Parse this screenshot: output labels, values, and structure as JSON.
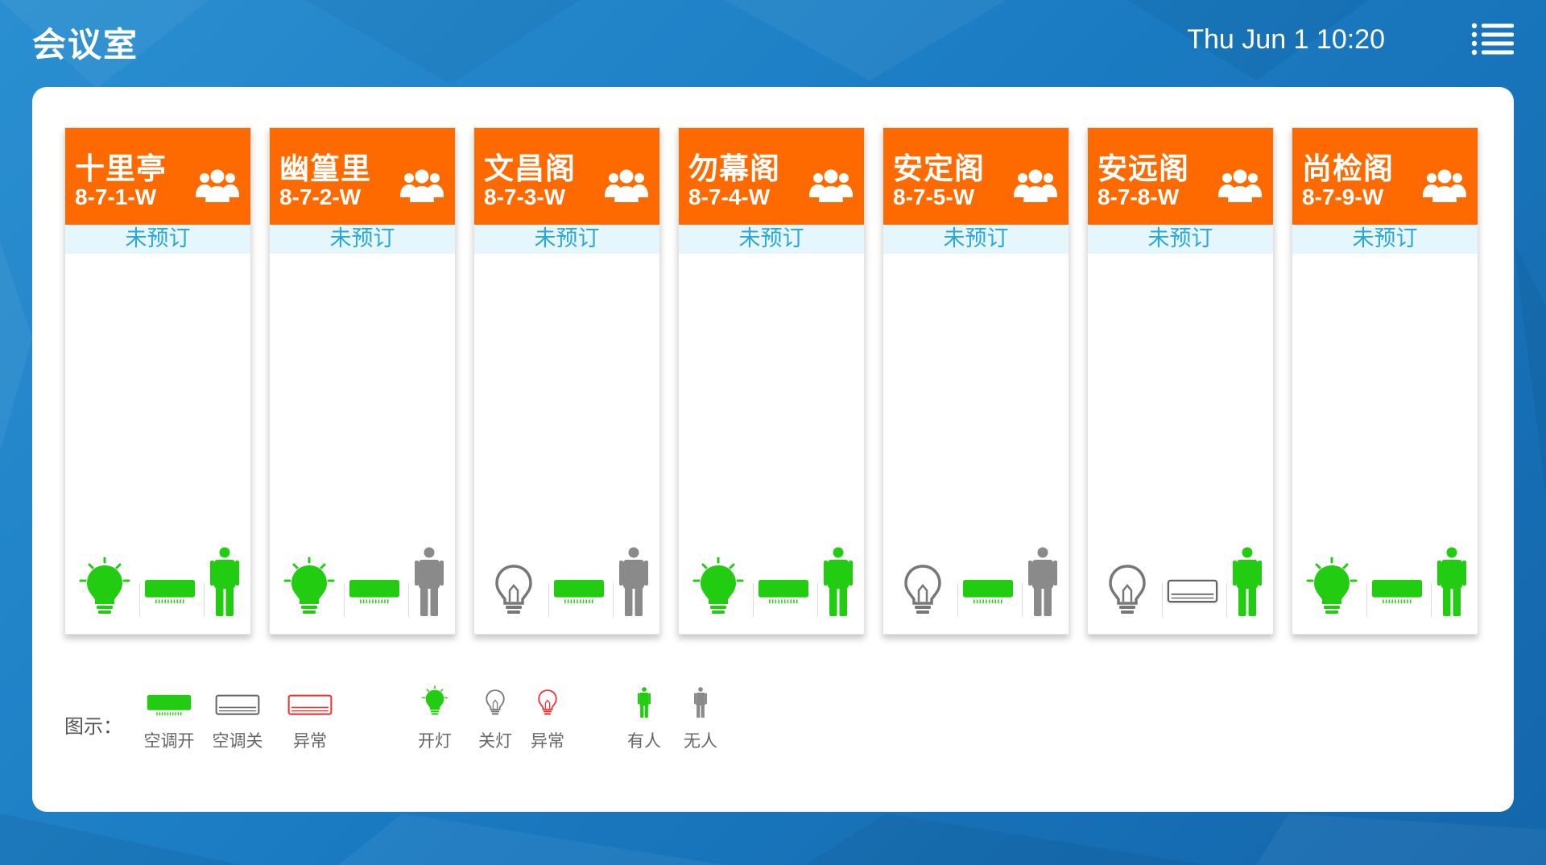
{
  "header": {
    "title": "会议室",
    "datetime": "Thu Jun 1 10:20",
    "menu_icon": "list-menu-icon"
  },
  "rooms": [
    {
      "name": "十里亭",
      "code": "8-7-1-W",
      "status": "未预订",
      "light": "on",
      "ac": "on",
      "occupancy": "occupied"
    },
    {
      "name": "幽篁里",
      "code": "8-7-2-W",
      "status": "未预订",
      "light": "on",
      "ac": "on",
      "occupancy": "vacant"
    },
    {
      "name": "文昌阁",
      "code": "8-7-3-W",
      "status": "未预订",
      "light": "off",
      "ac": "on",
      "occupancy": "vacant"
    },
    {
      "name": "勿幕阁",
      "code": "8-7-4-W",
      "status": "未预订",
      "light": "on",
      "ac": "on",
      "occupancy": "occupied"
    },
    {
      "name": "安定阁",
      "code": "8-7-5-W",
      "status": "未预订",
      "light": "off",
      "ac": "on",
      "occupancy": "vacant"
    },
    {
      "name": "安远阁",
      "code": "8-7-8-W",
      "status": "未预订",
      "light": "off",
      "ac": "off",
      "occupancy": "occupied"
    },
    {
      "name": "尚检阁",
      "code": "8-7-9-W",
      "status": "未预订",
      "light": "on",
      "ac": "on",
      "occupancy": "occupied"
    }
  ],
  "legend": {
    "title": "图示：",
    "items": [
      {
        "icon": "ac-on",
        "label": "空调开"
      },
      {
        "icon": "ac-off",
        "label": "空调关"
      },
      {
        "icon": "ac-error",
        "label": "异常"
      },
      {
        "icon": "light-on",
        "label": "开灯"
      },
      {
        "icon": "light-off",
        "label": "关灯"
      },
      {
        "icon": "light-error",
        "label": "异常"
      },
      {
        "icon": "person-present",
        "label": "有人"
      },
      {
        "icon": "person-absent",
        "label": "无人"
      }
    ]
  },
  "colors": {
    "header_orange": "#ff6a00",
    "on_green": "#22cc11",
    "off_gray": "#888888",
    "error_red": "#ee3333",
    "status_text": "#2aa8d9"
  }
}
